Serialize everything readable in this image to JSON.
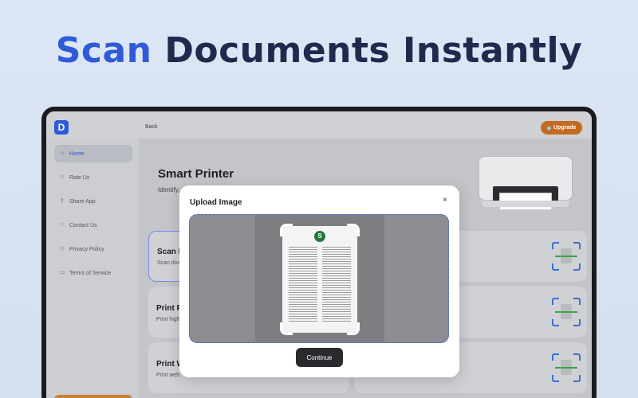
{
  "headline": {
    "accent": "Scan",
    "rest": "Documents Instantly"
  },
  "topbar": {
    "back_label": "Back",
    "upgrade_label": "Upgrade",
    "logo_letter": "D"
  },
  "sidebar": {
    "items": [
      {
        "label": "Home",
        "icon": "home-icon",
        "active": true
      },
      {
        "label": "Rate Us",
        "icon": "star-icon",
        "active": false
      },
      {
        "label": "Share App",
        "icon": "share-icon",
        "active": false
      },
      {
        "label": "Contact Us",
        "icon": "chat-icon",
        "active": false
      },
      {
        "label": "Privacy Policy",
        "icon": "shield-icon",
        "active": false
      },
      {
        "label": "Terms of Service",
        "icon": "document-icon",
        "active": false
      }
    ]
  },
  "content": {
    "title": "Smart Printer",
    "subtitle": "Identify, a",
    "cards": [
      {
        "title": "Scan F",
        "subtitle": "Scan doc"
      },
      {
        "title": "Print Pl",
        "subtitle": "Print high"
      },
      {
        "title": "Print W",
        "subtitle": "Print web"
      }
    ]
  },
  "modal": {
    "title": "Upload Image",
    "close_glyph": "×",
    "continue_label": "Continue",
    "badge_letter": "S"
  },
  "colors": {
    "accent": "#2f5ad8",
    "upgrade": "#c46a1f",
    "scan_line": "#3aa34a"
  }
}
